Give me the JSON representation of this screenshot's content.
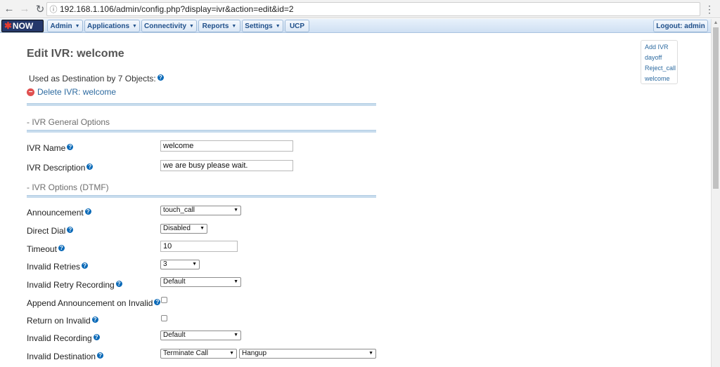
{
  "browser": {
    "url": "192.168.1.106/admin/config.php?display=ivr&action=edit&id=2",
    "back_glyph": "←",
    "forward_glyph": "→",
    "reload_glyph": "↻",
    "info_glyph": "ⓘ",
    "menu_glyph": "⋮"
  },
  "appnav": {
    "logo": "NOW",
    "menus": [
      {
        "label": "Admin",
        "caret": "▼"
      },
      {
        "label": "Applications",
        "caret": "▼"
      },
      {
        "label": "Connectivity",
        "caret": "▼"
      },
      {
        "label": "Reports",
        "caret": "▼"
      },
      {
        "label": "Settings",
        "caret": "▼"
      }
    ],
    "ucp": "UCP",
    "logout": "Logout: admin"
  },
  "page": {
    "title": "Edit IVR: welcome",
    "used_as": "Used as Destination by 7 Objects:",
    "help_glyph": "?",
    "delete_icon": "−",
    "delete_label": "Delete IVR: welcome",
    "section_general": "- IVR General Options",
    "section_dtmf": "- IVR Options (DTMF)"
  },
  "form": {
    "ivr_name": {
      "label": "IVR Name",
      "value": "welcome"
    },
    "ivr_description": {
      "label": "IVR Description",
      "value": "we are busy please wait."
    },
    "announcement": {
      "label": "Announcement",
      "value": "touch_call"
    },
    "direct_dial": {
      "label": "Direct Dial",
      "value": "Disabled"
    },
    "timeout": {
      "label": "Timeout",
      "value": "10"
    },
    "invalid_retries": {
      "label": "Invalid Retries",
      "value": "3"
    },
    "invalid_retry_recording": {
      "label": "Invalid Retry Recording",
      "value": "Default"
    },
    "append_announcement": {
      "label": "Append Announcement on Invalid",
      "checked": false
    },
    "return_on_invalid": {
      "label": "Return on Invalid",
      "checked": false
    },
    "invalid_recording": {
      "label": "Invalid Recording",
      "value": "Default"
    },
    "invalid_destination": {
      "label": "Invalid Destination",
      "value": "Terminate Call",
      "value2": "Hangup"
    }
  },
  "select_arrow": "▼",
  "right_nav": {
    "items": [
      "Add IVR",
      "dayoff",
      "Reject_call",
      "welcome"
    ]
  },
  "colors": {
    "accent": "#2c6aa0",
    "help": "#0b6ab8",
    "delete": "#e05050",
    "nav": "#cfe0f3"
  }
}
